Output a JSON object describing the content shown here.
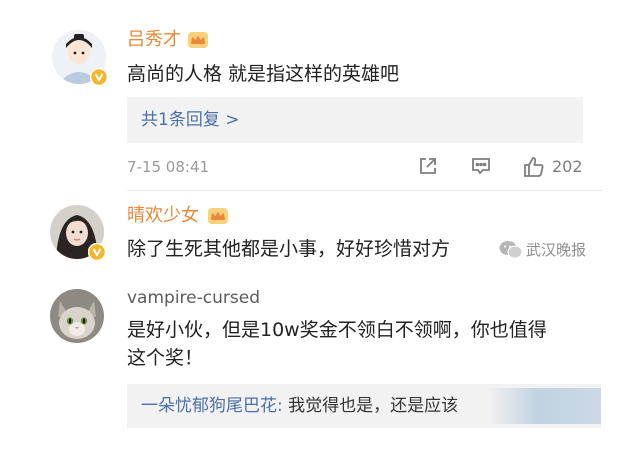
{
  "comments": [
    {
      "username": "吕秀才",
      "text": "高尚的人格 就是指这样的英雄吧",
      "reply_summary": "共1条回复 >",
      "timestamp": "7-15 08:41",
      "like_count": "202"
    },
    {
      "username": "晴欢少女",
      "text": "除了生死其他都是小事，好好珍惜对方"
    },
    {
      "username": "vampire-cursed",
      "text_line1": "是好小伙，但是10w奖金不领白不领啊，你也值得",
      "text_line2": "这个奖！",
      "reply_author": "一朵忧郁狗尾巴花:",
      "reply_text": " 我觉得也是，还是应该"
    }
  ],
  "watermark": "武汉晚报",
  "colors": {
    "username_vip": "#e8883a",
    "link": "#4c6fa8",
    "meta": "#9a9a9a",
    "badge": "#f5b629"
  }
}
